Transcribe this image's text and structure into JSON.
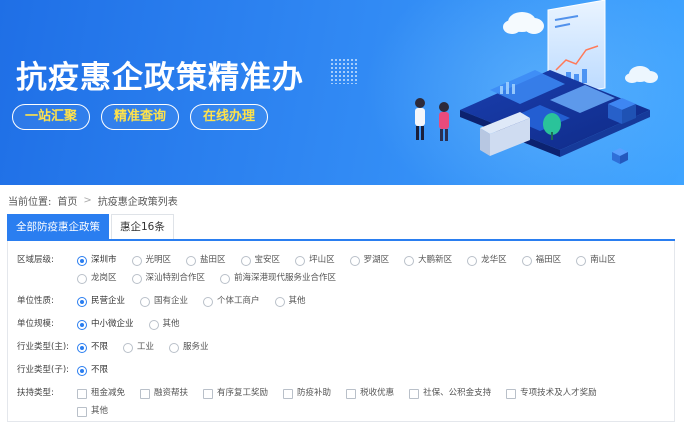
{
  "banner": {
    "title": "抗疫惠企政策精准办",
    "buttons": [
      "一站汇聚",
      "精准查询",
      "在线办理"
    ]
  },
  "breadcrumb": {
    "prefix": "当前位置:",
    "home": "首页",
    "separator": ">",
    "current": "抗疫惠企政策列表"
  },
  "tabs": [
    {
      "label": "全部防疫惠企政策",
      "active": true
    },
    {
      "label": "惠企16条",
      "active": false
    }
  ],
  "filters": [
    {
      "label": "区域层级:",
      "type": "radio",
      "options": [
        "深圳市",
        "光明区",
        "盐田区",
        "宝安区",
        "坪山区",
        "罗湖区",
        "大鹏新区",
        "龙华区",
        "福田区",
        "南山区",
        "龙岗区",
        "深汕特别合作区",
        "前海深港现代服务业合作区"
      ],
      "selected": "深圳市"
    },
    {
      "label": "单位性质:",
      "type": "radio",
      "options": [
        "民营企业",
        "国有企业",
        "个体工商户",
        "其他"
      ],
      "selected": "民营企业"
    },
    {
      "label": "单位规模:",
      "type": "radio",
      "options": [
        "中小微企业",
        "其他"
      ],
      "selected": "中小微企业"
    },
    {
      "label": "行业类型(主):",
      "type": "radio",
      "options": [
        "不限",
        "工业",
        "服务业"
      ],
      "selected": "不限"
    },
    {
      "label": "行业类型(子):",
      "type": "radio",
      "options": [
        "不限"
      ],
      "selected": "不限"
    },
    {
      "label": "扶持类型:",
      "type": "checkbox",
      "options": [
        "租金减免",
        "融资帮扶",
        "有序复工奖励",
        "防疫补助",
        "税收优惠",
        "社保、公积金支持",
        "专项技术及人才奖励",
        "其他"
      ],
      "selected": null
    }
  ],
  "colors": {
    "primary": "#2a7ef0",
    "pill_text": "#ffe24a",
    "banner_start": "#1f6fe6",
    "banner_end": "#3fa4ff"
  }
}
